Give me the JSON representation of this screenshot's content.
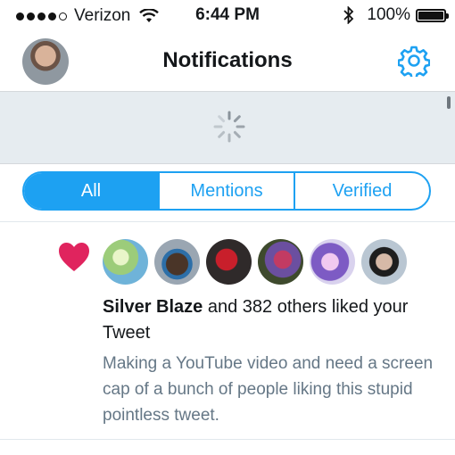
{
  "status_bar": {
    "carrier": "Verizon",
    "time": "6:44 PM",
    "battery": "100%",
    "signal_bars": 4,
    "signal_total": 5
  },
  "header": {
    "title": "Notifications",
    "settings_icon": "gear-icon",
    "accent_color": "#1da1f2"
  },
  "tabs": [
    {
      "label": "All",
      "active": true
    },
    {
      "label": "Mentions",
      "active": false
    },
    {
      "label": "Verified",
      "active": false
    }
  ],
  "notification": {
    "type_icon": "heart-icon",
    "icon_color": "#e0245e",
    "actor": "Silver Blaze",
    "action": "and 382 others liked your Tweet",
    "tweet_text": "Making a YouTube video and need a screen cap of a bunch of people liking this stupid pointless tweet."
  }
}
